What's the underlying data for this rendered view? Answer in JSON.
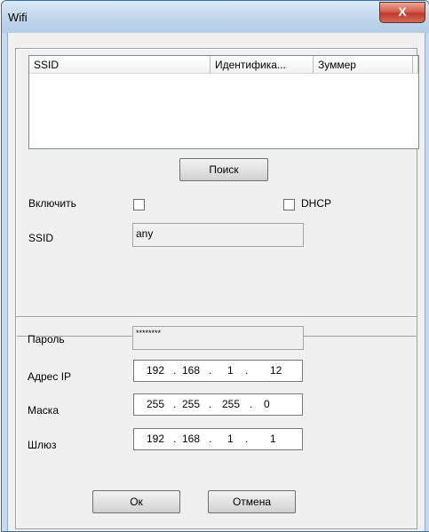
{
  "window": {
    "title": "Wifi",
    "close_glyph": "X"
  },
  "network_list": {
    "columns": [
      "SSID",
      "Идентифика...",
      "Зуммер"
    ]
  },
  "search_button": "Поиск",
  "enable": {
    "label": "Включить",
    "checked": false
  },
  "dhcp": {
    "label": "DHCP",
    "checked": false
  },
  "ssid": {
    "label": "SSID",
    "value": "any"
  },
  "password": {
    "label": "Пароль",
    "value": "********"
  },
  "ip_address": {
    "label": "Адрес IP",
    "octets": [
      "192",
      "168",
      "1",
      "12"
    ]
  },
  "mask": {
    "label": "Маска",
    "octets": [
      "255",
      "255",
      "255",
      "0"
    ]
  },
  "gateway": {
    "label": "Шлюз",
    "octets": [
      "192",
      "168",
      "1",
      "1"
    ]
  },
  "buttons": {
    "ok": "Ок",
    "cancel": "Отмена"
  },
  "ip_separator": "."
}
